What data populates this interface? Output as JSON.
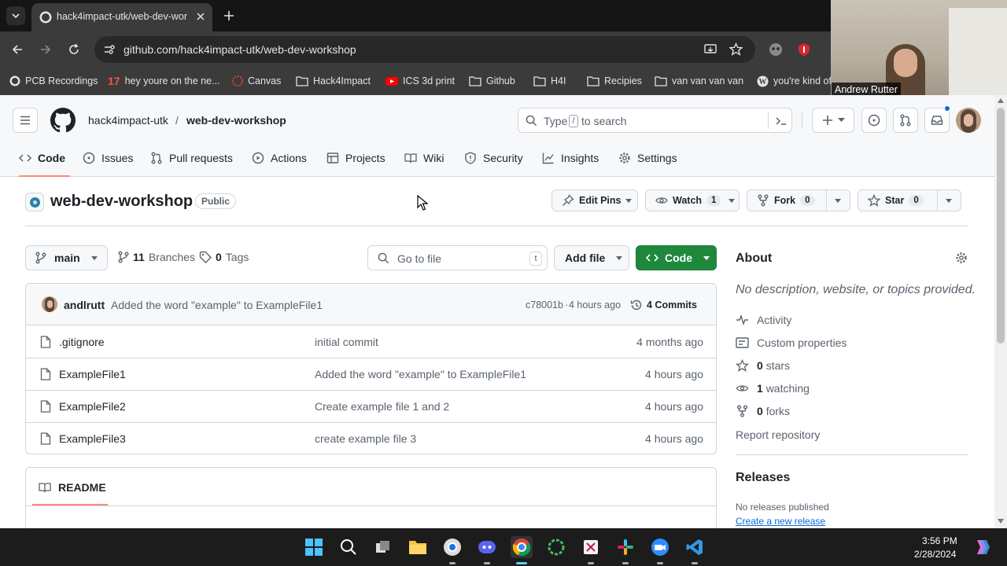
{
  "browser": {
    "tab_title": "hack4impact-utk/web-dev-wor",
    "url": "github.com/hack4impact-utk/web-dev-workshop",
    "bookmarks": [
      "PCB Recordings",
      "hey youre on the ne...",
      "Canvas",
      "Hack4Impact",
      "ICS 3d print",
      "Github",
      "H4I",
      "Recipies",
      "van van van van",
      "you're kind of"
    ]
  },
  "webcam": {
    "name": "Andrew Rutter"
  },
  "header": {
    "owner": "hack4impact-utk",
    "separator": "/",
    "repo": "web-dev-workshop",
    "search_prefix": "Type",
    "search_key": "/",
    "search_suffix": "to search"
  },
  "nav": {
    "tabs": [
      {
        "label": "Code",
        "icon": "code-icon"
      },
      {
        "label": "Issues",
        "icon": "issue-icon"
      },
      {
        "label": "Pull requests",
        "icon": "pull-request-icon"
      },
      {
        "label": "Actions",
        "icon": "play-icon"
      },
      {
        "label": "Projects",
        "icon": "table-icon"
      },
      {
        "label": "Wiki",
        "icon": "book-icon"
      },
      {
        "label": "Security",
        "icon": "shield-icon"
      },
      {
        "label": "Insights",
        "icon": "graph-icon"
      },
      {
        "label": "Settings",
        "icon": "gear-icon"
      }
    ]
  },
  "repo": {
    "name": "web-dev-workshop",
    "visibility": "Public",
    "edit_pins": "Edit Pins",
    "watch_label": "Watch",
    "watch_count": "1",
    "fork_label": "Fork",
    "fork_count": "0",
    "star_label": "Star",
    "star_count": "0"
  },
  "toolbar": {
    "branch": "main",
    "branches_count": "11",
    "branches_label": "Branches",
    "tags_count": "0",
    "tags_label": "Tags",
    "go_to_file": "Go to file",
    "go_to_file_key": "t",
    "add_file": "Add file",
    "code": "Code"
  },
  "latest_commit": {
    "author": "andlrutt",
    "message": "Added the word \"example\" to ExampleFile1",
    "sha": "c78001b",
    "dot": "·",
    "time": "4 hours ago",
    "commits": "4 Commits"
  },
  "files": [
    {
      "name": ".gitignore",
      "message": "initial commit",
      "date": "4 months ago"
    },
    {
      "name": "ExampleFile1",
      "message": "Added the word \"example\" to ExampleFile1",
      "date": "4 hours ago"
    },
    {
      "name": "ExampleFile2",
      "message": "Create example file 1 and 2",
      "date": "4 hours ago"
    },
    {
      "name": "ExampleFile3",
      "message": "create example file 3",
      "date": "4 hours ago"
    }
  ],
  "readme": {
    "label": "README"
  },
  "about": {
    "title": "About",
    "description": "No description, website, or topics provided.",
    "activity": "Activity",
    "custom_properties": "Custom properties",
    "stars_count": "0",
    "stars_label": "stars",
    "watching_count": "1",
    "watching_label": "watching",
    "forks_count": "0",
    "forks_label": "forks",
    "report": "Report repository"
  },
  "releases": {
    "title": "Releases",
    "none": "No releases published",
    "create": "Create a new release"
  },
  "taskbar": {
    "time": "3:56 PM",
    "date": "2/28/2024"
  },
  "colors": {
    "accent_green": "#1f883d",
    "underline": "#fd8c73",
    "link": "#0969da"
  }
}
